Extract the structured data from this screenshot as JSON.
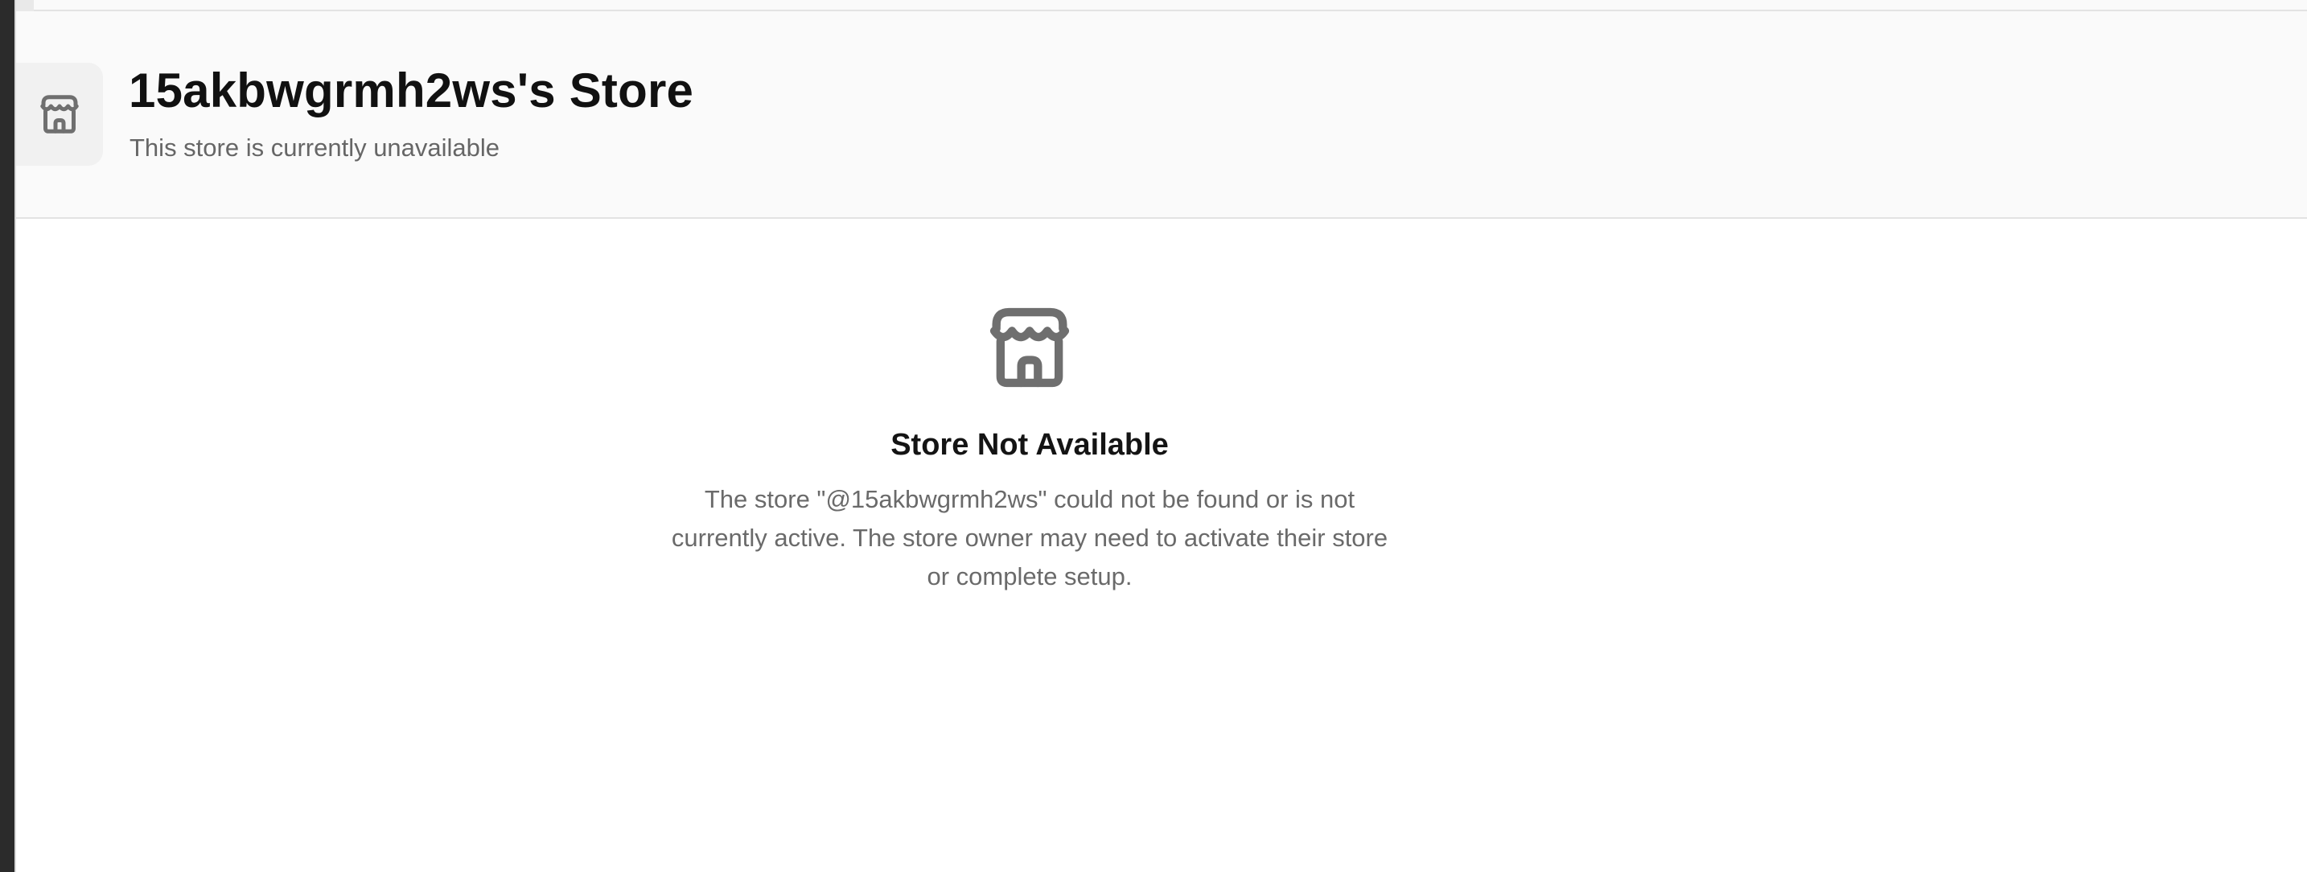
{
  "header": {
    "title": "15akbwgrmh2ws's Store",
    "subtitle": "This store is currently unavailable",
    "icon": "store-icon"
  },
  "empty_state": {
    "icon": "store-icon",
    "title": "Store Not Available",
    "message": "The store \"@15akbwgrmh2ws\" could not be found or is not currently active. The store owner may need to activate their store or complete setup."
  },
  "colors": {
    "icon_gray": "#6f6f6f",
    "header_bg": "#fafafa",
    "title_text": "#111111",
    "muted_text": "#666666"
  }
}
